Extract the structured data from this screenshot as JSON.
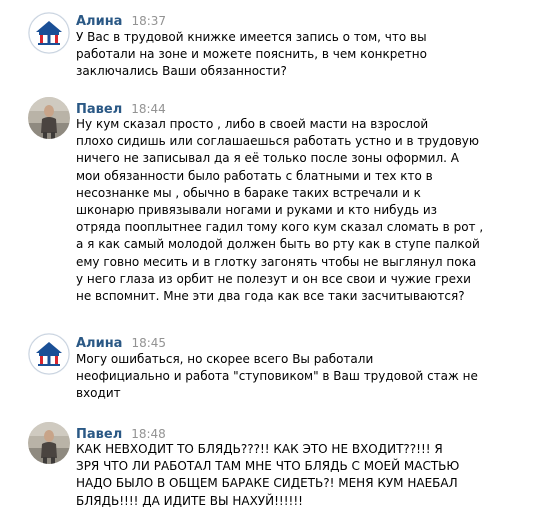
{
  "messages": [
    {
      "author": "Алина",
      "time": "18:37",
      "text": "У Вас в трудовой книжке имеется запись о том, что вы\nработали на зоне и можете пояснить, в чем конкретно\nзаключались Ваши обязанности?",
      "avatar": "pension-fund-logo"
    },
    {
      "author": "Павел",
      "time": "18:44",
      "text": "Ну кум сказал просто , либо в своей масти на взрослой\nплохо сидишь или соглашаешься работать устно и в трудовую\nничего не записывал да я её только после зоны оформил. А\nмои обязанности было работать с блатными и тех кто в\nнесознанке мы , обычно в бараке таких встречали и к\nшконарю привязывали ногами и руками и кто нибудь из\nотряда пооплытнее гадил тому кого кум сказал сломать в рот ,\nа я как самый молодой должен быть во рту как в ступе палкой\nему говно месить и в глотку загонять чтобы не выглянул пока\nу него глаза из орбит не полезут и он все свои и чужие грехи\nне вспомнит. Мне эти два года как все таки засчитываются?",
      "avatar": "user-photo"
    },
    {
      "author": "Алина",
      "time": "18:45",
      "text": "Могу ошибаться, но скорее всего Вы работали\nнеофициально и работа \"ступовиком\" в Ваш трудовой стаж не\nвходит",
      "avatar": "pension-fund-logo"
    },
    {
      "author": "Павел",
      "time": "18:48",
      "text": "КАК НЕВХОДИТ ТО БЛЯДЬ???!! КАК ЭТО НЕ ВХОДИТ??!!! Я\nЗРЯ ЧТО ЛИ РАБОТАЛ ТАМ МНЕ ЧТО БЛЯДЬ С МОЕЙ МАСТЬЮ\nНАДО БЫЛО В ОБЩЕМ БАРАКЕ СИДЕТЬ?! МЕНЯ КУМ НАЕБАЛ\nБЛЯДЬ!!!! ДА ИДИТЕ ВЫ НАХУЙ!!!!!!",
      "avatar": "user-photo"
    }
  ],
  "colors": {
    "author": "#2a5885",
    "time": "#939393",
    "text": "#000000",
    "pfr_blue": "#1a4f96"
  }
}
